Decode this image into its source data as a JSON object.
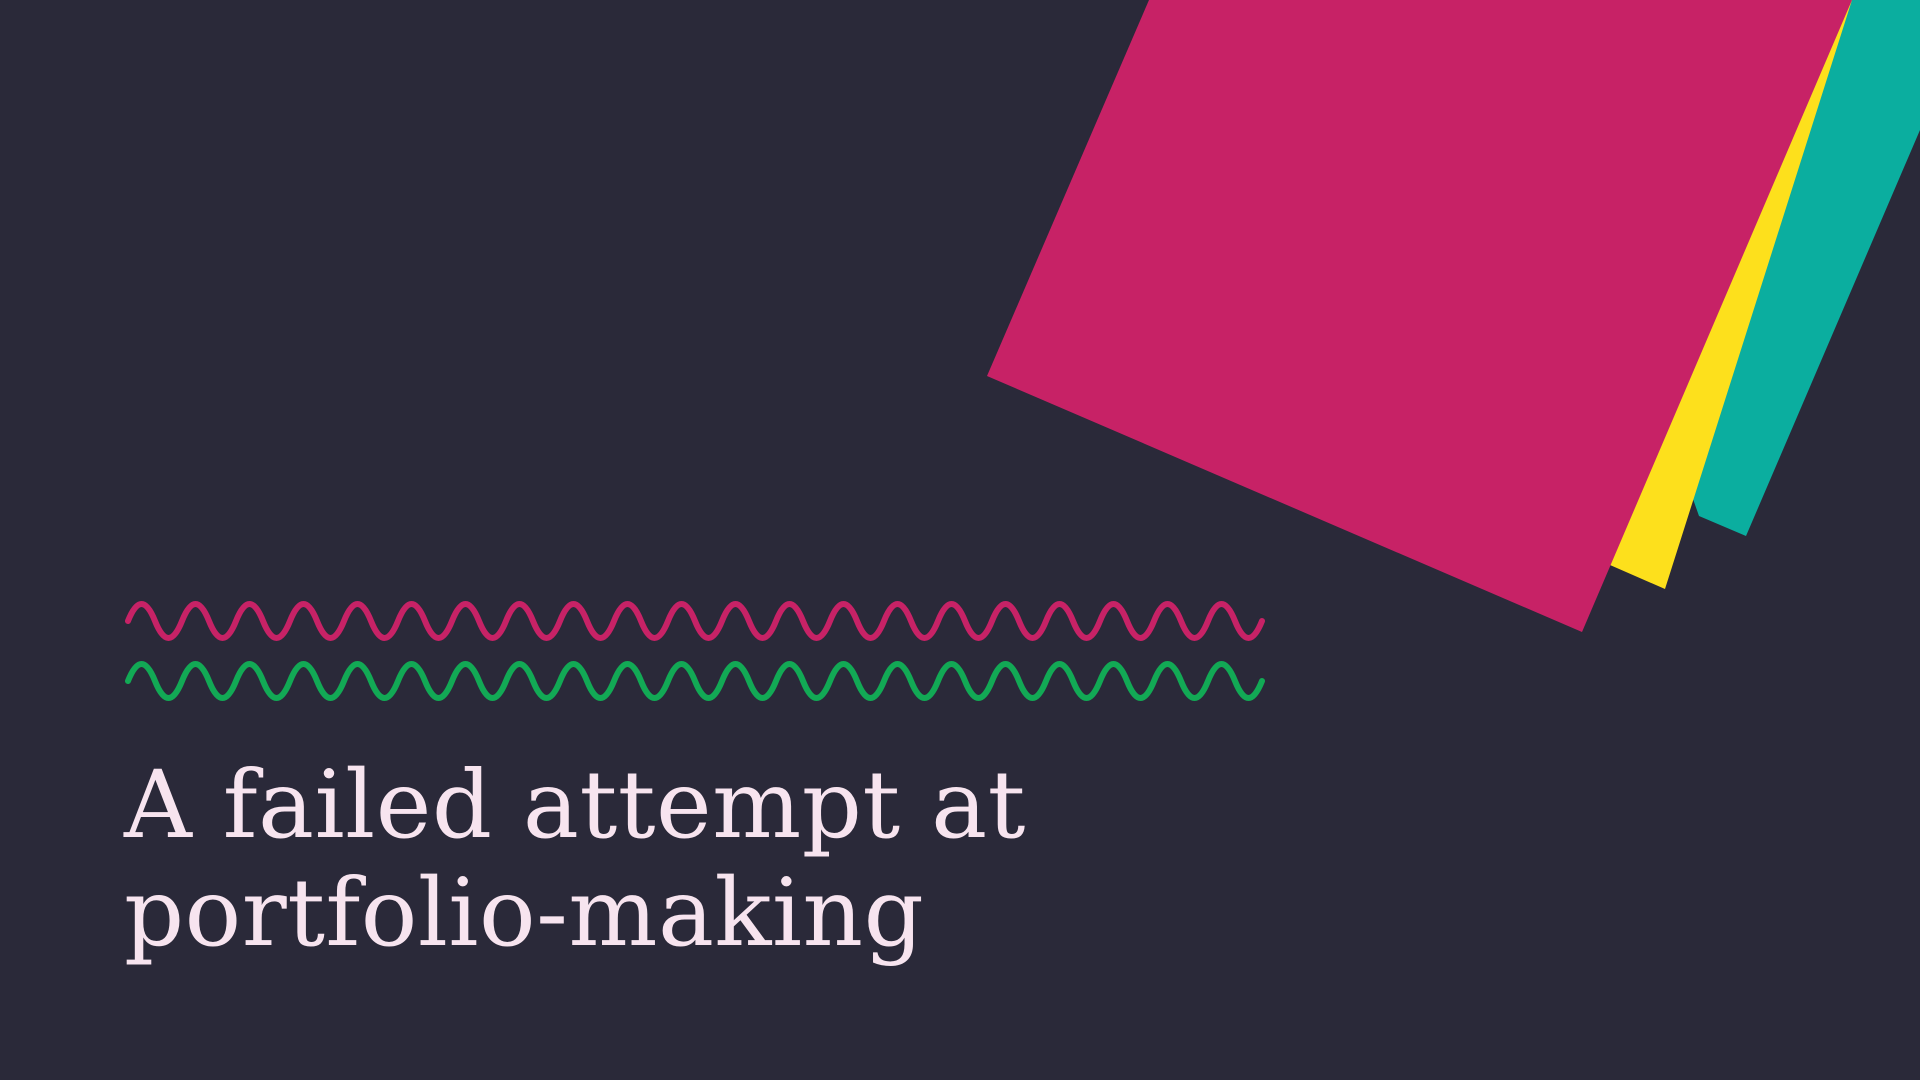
{
  "slide": {
    "title_line1": "A failed attempt at",
    "title_line2": "portfolio-making"
  },
  "colors": {
    "background": "#2a2939",
    "magenta": "#c72266",
    "yellow": "#fde01c",
    "teal": "#0bae9f",
    "wave_top": "#c72266",
    "wave_bottom": "#12a955",
    "title_text": "#f7e4ef"
  }
}
